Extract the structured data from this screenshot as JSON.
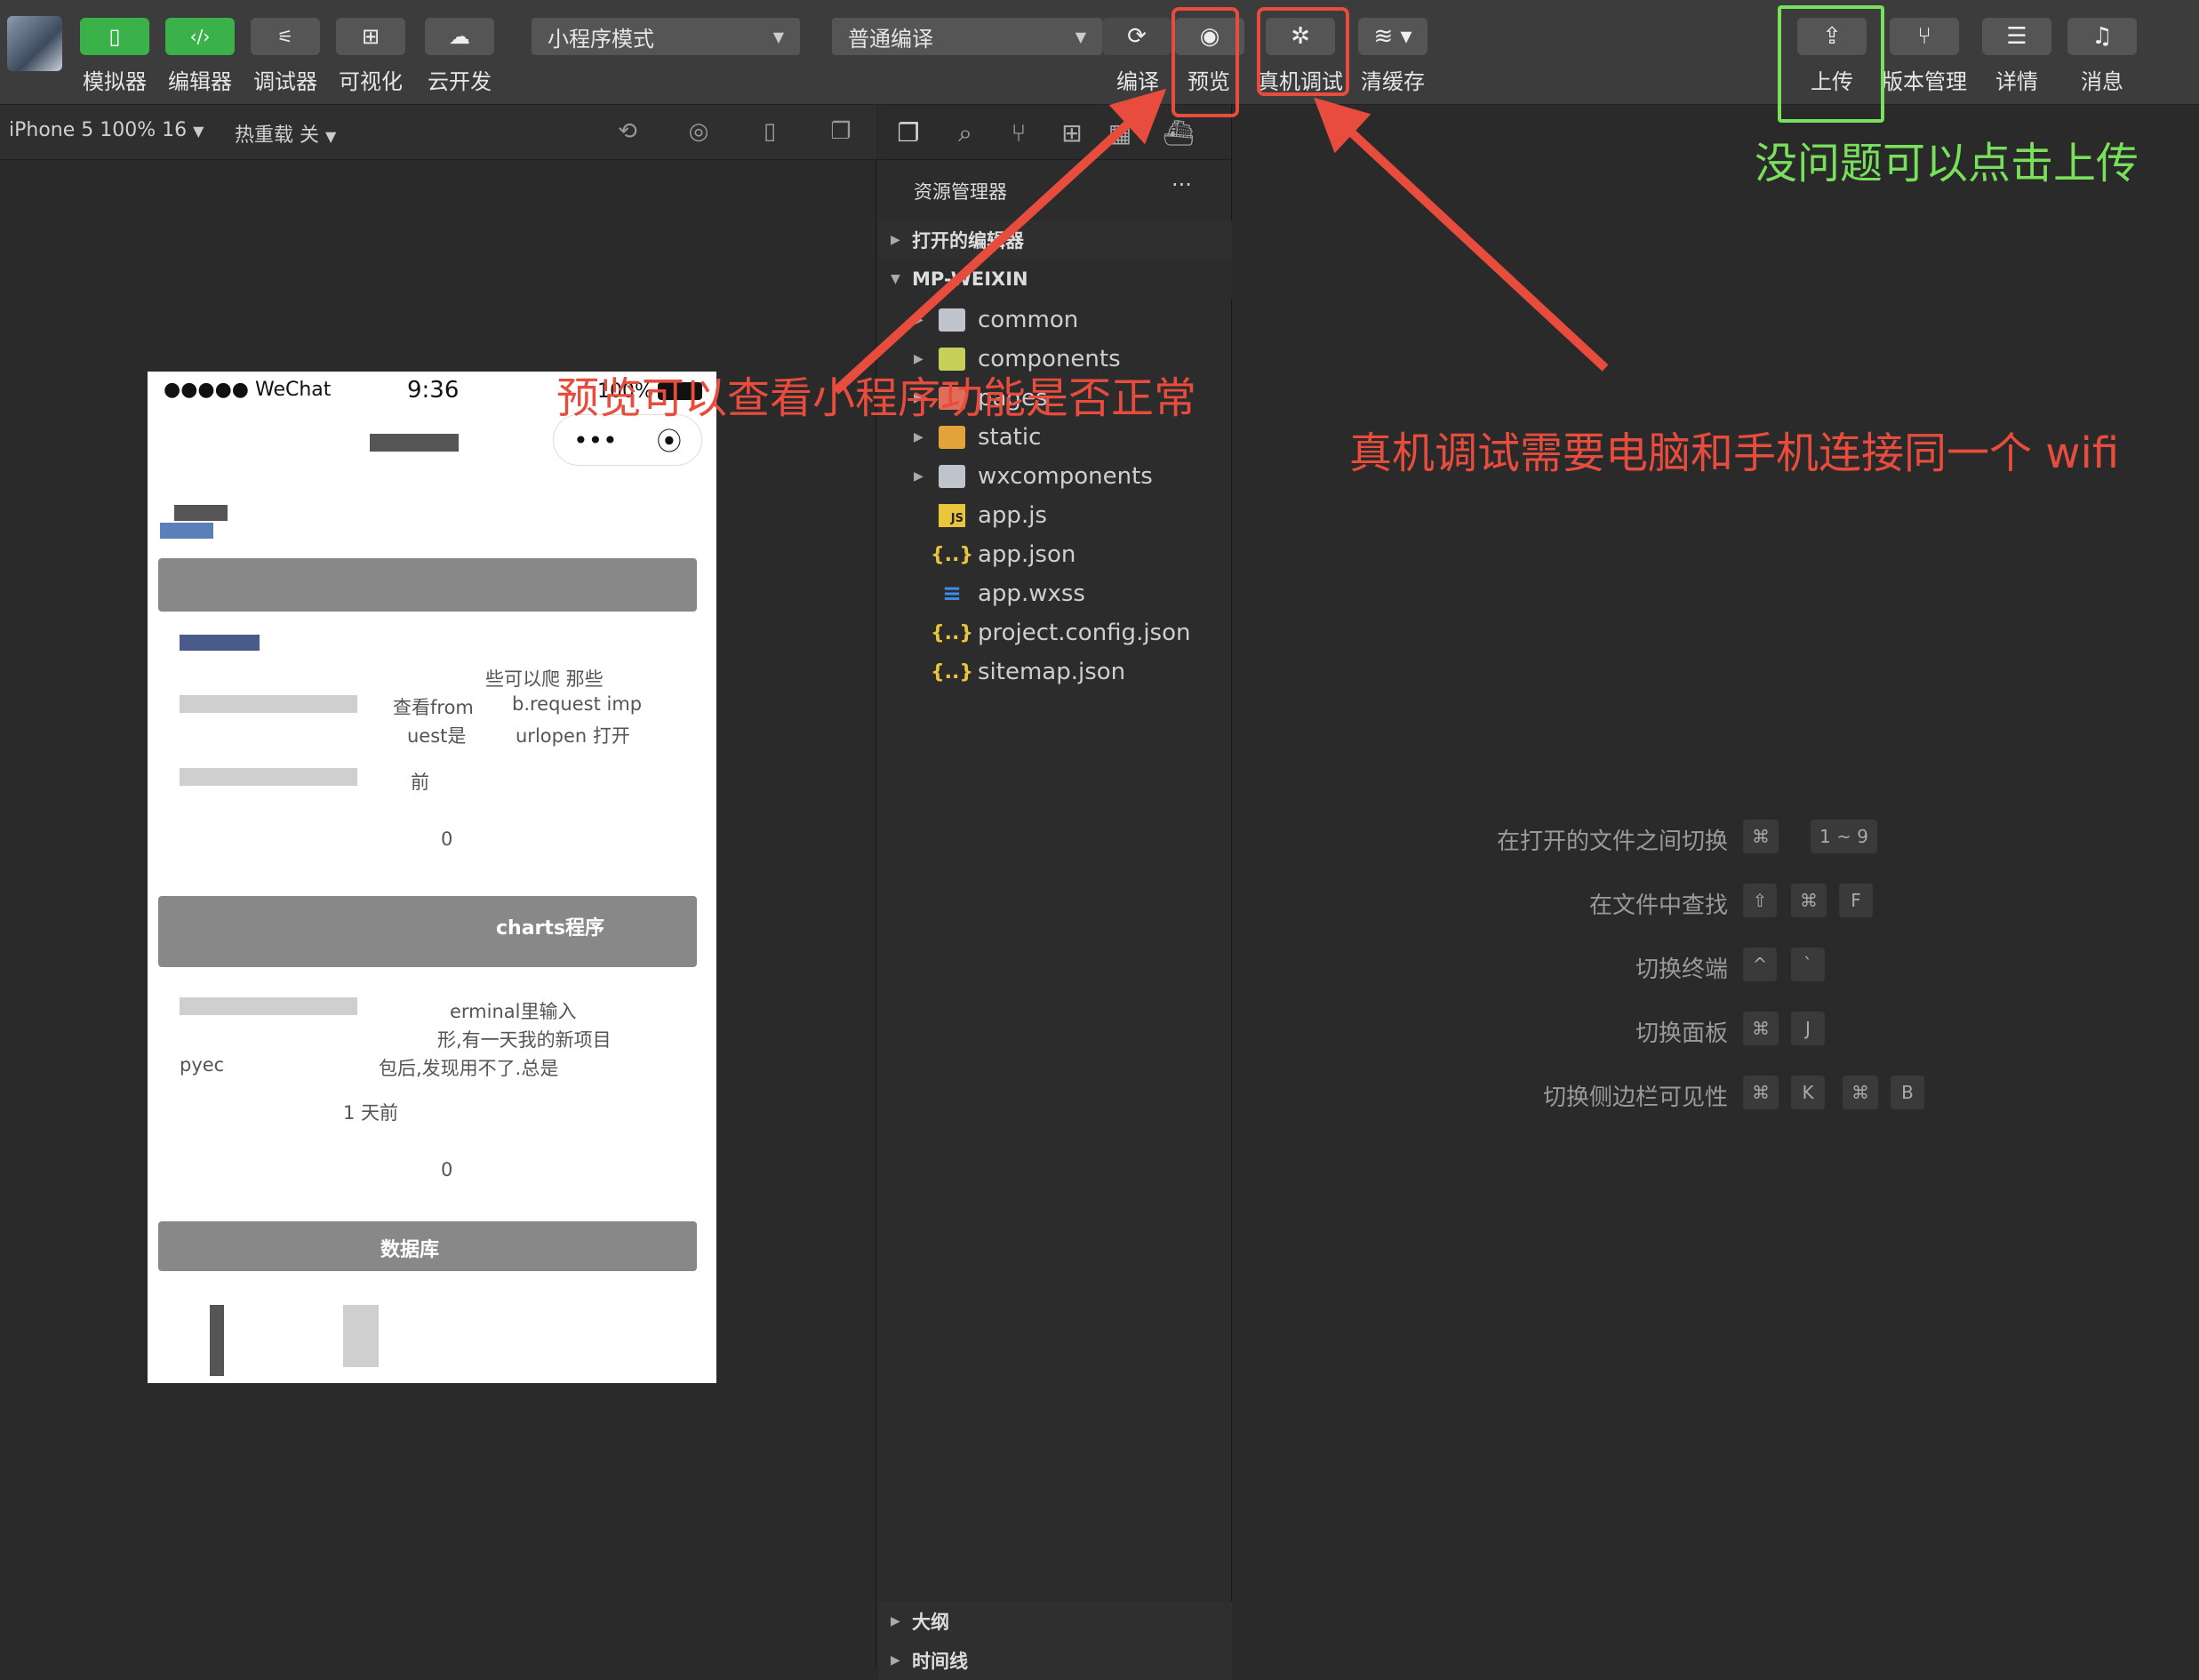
{
  "toolbar": {
    "mode_buttons": [
      {
        "label": "模拟器",
        "icon": "phone-icon"
      },
      {
        "label": "编辑器",
        "icon": "code-icon"
      },
      {
        "label": "调试器",
        "icon": "debug-icon"
      },
      {
        "label": "可视化",
        "icon": "layout-icon"
      },
      {
        "label": "云开发",
        "icon": "cloud-icon"
      }
    ],
    "mode_select": "小程序模式",
    "compile_select": "普通编译",
    "compile_label": "编译",
    "preview_label": "预览",
    "remote_debug_label": "真机调试",
    "clear_cache_label": "清缓存",
    "upload_label": "上传",
    "version_label": "版本管理",
    "details_label": "详情",
    "messages_label": "消息"
  },
  "subbar": {
    "device": "iPhone 5 100% 16",
    "hot_reload": "热重载 关"
  },
  "phone": {
    "status_left": "●●●●● WeChat",
    "time": "9:36",
    "battery": "100%",
    "snippets": [
      "些可以爬 那些",
      "查看from",
      "b.request imp",
      "uest是",
      "urlopen 打开",
      "前",
      "0",
      "charts程序",
      "erminal里输入",
      "形,有一天我的新项目",
      "pyec",
      "包后,发现用不了.总是",
      "1 天前",
      "0",
      "数据库"
    ]
  },
  "explorer": {
    "title": "资源管理器",
    "more": "···",
    "open_editors": "打开的编辑器",
    "project": "MP-WEIXIN",
    "tree": [
      {
        "name": "common",
        "type": "folder"
      },
      {
        "name": "components",
        "type": "folder"
      },
      {
        "name": "pages",
        "type": "folder"
      },
      {
        "name": "static",
        "type": "folder"
      },
      {
        "name": "wxcomponents",
        "type": "folder"
      },
      {
        "name": "app.js",
        "type": "js"
      },
      {
        "name": "app.json",
        "type": "json"
      },
      {
        "name": "app.wxss",
        "type": "wxss"
      },
      {
        "name": "project.config.json",
        "type": "json"
      },
      {
        "name": "sitemap.json",
        "type": "json"
      }
    ],
    "outline": "大纲",
    "timeline": "时间线"
  },
  "editor_hints": [
    {
      "label": "在打开的文件之间切换",
      "keys": [
        "⌘",
        "1 ~ 9"
      ]
    },
    {
      "label": "在文件中查找",
      "keys": [
        "⇧",
        "⌘",
        "F"
      ]
    },
    {
      "label": "切换终端",
      "keys": [
        "^",
        "`"
      ]
    },
    {
      "label": "切换面板",
      "keys": [
        "⌘",
        "J"
      ]
    },
    {
      "label": "切换侧边栏可见性",
      "keys": [
        "⌘",
        "K",
        "⌘",
        "B"
      ]
    }
  ],
  "annotations": {
    "preview_note": "预览可以查看小程序功能是否正常",
    "remote_note": "真机调试需要电脑和手机连接同一个 wifi",
    "upload_note": "没问题可以点击上传",
    "red": "#e74c3c",
    "green": "#78e05a"
  }
}
